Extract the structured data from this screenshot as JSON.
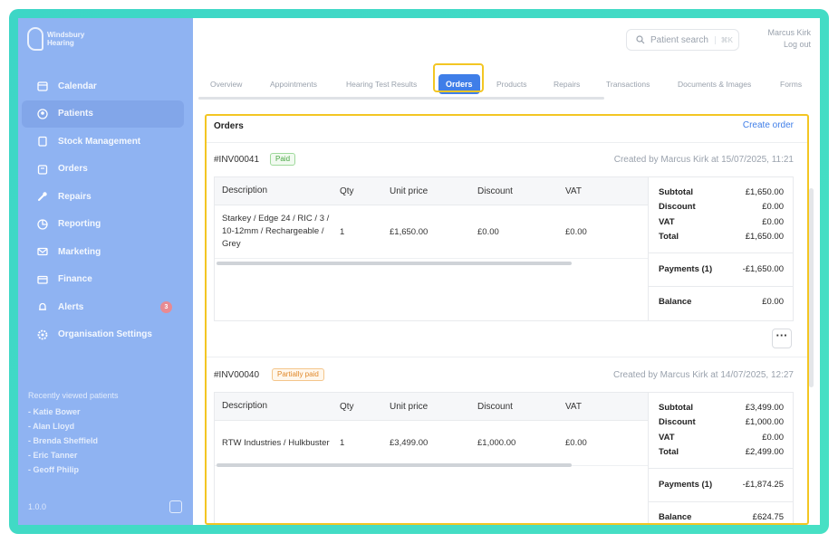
{
  "app": {
    "logo_line1": "Windsbury",
    "logo_line2": "Hearing",
    "version": "1.0.0"
  },
  "sidebar": {
    "items": [
      {
        "label": "Calendar",
        "icon": "calendar-icon"
      },
      {
        "label": "Patients",
        "icon": "user-icon",
        "active": true
      },
      {
        "label": "Stock Management",
        "icon": "clipboard-icon"
      },
      {
        "label": "Orders",
        "icon": "orders-icon"
      },
      {
        "label": "Repairs",
        "icon": "wrench-icon"
      },
      {
        "label": "Reporting",
        "icon": "chart-icon"
      },
      {
        "label": "Marketing",
        "icon": "mail-icon"
      },
      {
        "label": "Finance",
        "icon": "card-icon"
      },
      {
        "label": "Alerts",
        "icon": "bell-icon",
        "badge": "3"
      },
      {
        "label": "Organisation Settings",
        "icon": "gear-icon"
      }
    ],
    "recent_heading": "Recently viewed patients",
    "recent": [
      "- Katie Bower",
      "- Alan Lloyd",
      "- Brenda Sheffield",
      "- Eric Tanner",
      "- Geoff Philip"
    ]
  },
  "header": {
    "search_placeholder": "Patient search",
    "search_shortcut": "⌘K",
    "user_name": "Marcus Kirk",
    "logout": "Log out"
  },
  "tabs": [
    "Overview",
    "Appointments",
    "Hearing Test Results",
    "Orders",
    "Products",
    "Repairs",
    "Transactions",
    "Documents & Images",
    "Forms"
  ],
  "active_tab": "Orders",
  "orders": {
    "title": "Orders",
    "create_label": "Create order",
    "columns": [
      "Description",
      "Qty",
      "Unit price",
      "Discount",
      "VAT"
    ],
    "list": [
      {
        "number": "#INV00041",
        "status": "Paid",
        "created": "Created by Marcus Kirk at 15/07/2025, 11:21",
        "line": {
          "description": "Starkey / Edge 24 / RIC / 3 / 10-12mm / Rechargeable / Grey",
          "qty": "1",
          "unit_price": "£1,650.00",
          "discount": "£0.00",
          "vat": "£0.00"
        },
        "summary": {
          "subtotal_label": "Subtotal",
          "subtotal": "£1,650.00",
          "discount_label": "Discount",
          "discount": "£0.00",
          "vat_label": "VAT",
          "vat": "£0.00",
          "total_label": "Total",
          "total": "£1,650.00",
          "payments_label": "Payments (1)",
          "payments": "-£1,650.00",
          "balance_label": "Balance",
          "balance": "£0.00"
        }
      },
      {
        "number": "#INV00040",
        "status": "Partially paid",
        "created": "Created by Marcus Kirk at 14/07/2025, 12:27",
        "line": {
          "description": "RTW Industries / Hulkbuster",
          "qty": "1",
          "unit_price": "£3,499.00",
          "discount": "£1,000.00",
          "vat": "£0.00"
        },
        "summary": {
          "subtotal_label": "Subtotal",
          "subtotal": "£3,499.00",
          "discount_label": "Discount",
          "discount": "£1,000.00",
          "vat_label": "VAT",
          "vat": "£0.00",
          "total_label": "Total",
          "total": "£2,499.00",
          "payments_label": "Payments (1)",
          "payments": "-£1,874.25",
          "balance_label": "Balance",
          "balance": "£624.75"
        }
      }
    ]
  },
  "colors": {
    "accent": "#3f7ee8",
    "highlight": "#f3c623",
    "sidebar": "#8fb3f2",
    "frame": "#3dd6c6"
  }
}
